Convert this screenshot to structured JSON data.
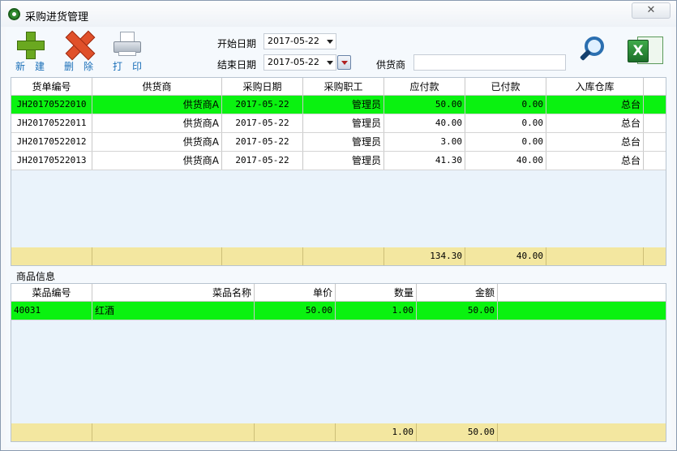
{
  "window": {
    "title": "采购进货管理",
    "close_glyph": "✕"
  },
  "toolbar": {
    "new_label": "新建",
    "delete_label": "删除",
    "print_label": "打印",
    "start_date_label": "开始日期",
    "start_date_value": "2017-05-22",
    "end_date_label": "结束日期",
    "end_date_value": "2017-05-22",
    "supplier_label": "供货商",
    "supplier_value": ""
  },
  "orders": {
    "columns": [
      "货单编号",
      "供货商",
      "采购日期",
      "采购职工",
      "应付款",
      "已付款",
      "入库仓库"
    ],
    "rows": [
      {
        "id": "JH20170522010",
        "supplier": "供货商A",
        "date": "2017-05-22",
        "staff": "管理员",
        "payable": "50.00",
        "paid": "0.00",
        "warehouse": "总台"
      },
      {
        "id": "JH20170522011",
        "supplier": "供货商A",
        "date": "2017-05-22",
        "staff": "管理员",
        "payable": "40.00",
        "paid": "0.00",
        "warehouse": "总台"
      },
      {
        "id": "JH20170522012",
        "supplier": "供货商A",
        "date": "2017-05-22",
        "staff": "管理员",
        "payable": "3.00",
        "paid": "0.00",
        "warehouse": "总台"
      },
      {
        "id": "JH20170522013",
        "supplier": "供货商A",
        "date": "2017-05-22",
        "staff": "管理员",
        "payable": "41.30",
        "paid": "40.00",
        "warehouse": "总台"
      }
    ],
    "total_payable": "134.30",
    "total_paid": "40.00",
    "selected_row": 0
  },
  "goods": {
    "section_title": "商品信息",
    "columns": [
      "菜品编号",
      "菜品名称",
      "单价",
      "数量",
      "金额"
    ],
    "rows": [
      {
        "code": "40031",
        "name": "红酒",
        "price": "50.00",
        "qty": "1.00",
        "amount": "50.00"
      }
    ],
    "total_qty": "1.00",
    "total_amount": "50.00",
    "selected_row": 0
  }
}
